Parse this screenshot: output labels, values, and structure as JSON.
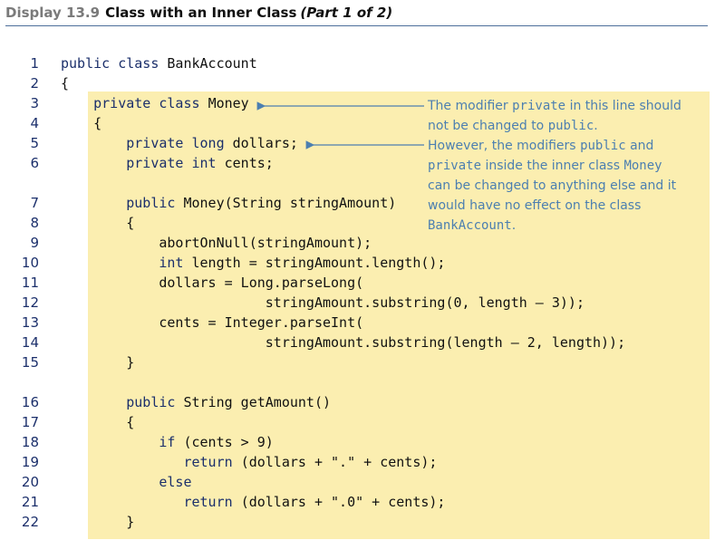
{
  "header": {
    "display": "Display 13.9",
    "title": "Class with an Inner Class",
    "part": "(Part 1 of 2)"
  },
  "lines": [
    {
      "n": "1",
      "segs": [
        [
          "kw",
          "public class "
        ],
        [
          "tx",
          "BankAccount"
        ]
      ]
    },
    {
      "n": "2",
      "segs": [
        [
          "tx",
          "{"
        ]
      ]
    },
    {
      "n": "3",
      "segs": [
        [
          "tx",
          "    "
        ],
        [
          "kw",
          "private class "
        ],
        [
          "tx",
          "Money"
        ]
      ]
    },
    {
      "n": "4",
      "segs": [
        [
          "tx",
          "    {"
        ]
      ]
    },
    {
      "n": "5",
      "segs": [
        [
          "tx",
          "        "
        ],
        [
          "kw",
          "private long "
        ],
        [
          "tx",
          "dollars;"
        ]
      ]
    },
    {
      "n": "6",
      "segs": [
        [
          "tx",
          "        "
        ],
        [
          "kw",
          "private int "
        ],
        [
          "tx",
          "cents;"
        ]
      ]
    },
    {
      "n": "7",
      "segs": [
        [
          "tx",
          "        "
        ],
        [
          "kw",
          "public "
        ],
        [
          "tx",
          "Money(String stringAmount)"
        ]
      ]
    },
    {
      "n": "8",
      "segs": [
        [
          "tx",
          "        {"
        ]
      ]
    },
    {
      "n": "9",
      "segs": [
        [
          "tx",
          "            abortOnNull(stringAmount);"
        ]
      ]
    },
    {
      "n": "10",
      "segs": [
        [
          "tx",
          "            "
        ],
        [
          "kw",
          "int "
        ],
        [
          "tx",
          "length = stringAmount.length();"
        ]
      ]
    },
    {
      "n": "11",
      "segs": [
        [
          "tx",
          "            dollars = Long.parseLong("
        ]
      ]
    },
    {
      "n": "12",
      "segs": [
        [
          "tx",
          "                         stringAmount.substring(0, length – 3));"
        ]
      ]
    },
    {
      "n": "13",
      "segs": [
        [
          "tx",
          "            cents = Integer.parseInt("
        ]
      ]
    },
    {
      "n": "14",
      "segs": [
        [
          "tx",
          "                         stringAmount.substring(length – 2, length));"
        ]
      ]
    },
    {
      "n": "15",
      "segs": [
        [
          "tx",
          "        }"
        ]
      ]
    },
    {
      "n": "16",
      "segs": [
        [
          "tx",
          "        "
        ],
        [
          "kw",
          "public "
        ],
        [
          "tx",
          "String getAmount()"
        ]
      ]
    },
    {
      "n": "17",
      "segs": [
        [
          "tx",
          "        {"
        ]
      ]
    },
    {
      "n": "18",
      "segs": [
        [
          "tx",
          "            "
        ],
        [
          "kw",
          "if "
        ],
        [
          "tx",
          "(cents > 9)"
        ]
      ]
    },
    {
      "n": "19",
      "segs": [
        [
          "tx",
          "               "
        ],
        [
          "kw",
          "return "
        ],
        [
          "tx",
          "(dollars + \".\" + cents);"
        ]
      ]
    },
    {
      "n": "20",
      "segs": [
        [
          "tx",
          "            "
        ],
        [
          "kw",
          "else"
        ]
      ]
    },
    {
      "n": "21",
      "segs": [
        [
          "tx",
          "               "
        ],
        [
          "kw",
          "return "
        ],
        [
          "tx",
          "(dollars + \".0\" + cents);"
        ]
      ]
    },
    {
      "n": "22",
      "segs": [
        [
          "tx",
          "        }"
        ]
      ]
    }
  ],
  "annotation": {
    "lines": [
      [
        [
          "t",
          "The modifier "
        ],
        [
          "m",
          "private"
        ],
        [
          "t",
          " in this line should"
        ]
      ],
      [
        [
          "t",
          "not be changed to "
        ],
        [
          "m",
          "public"
        ],
        [
          "t",
          "."
        ]
      ],
      [
        [
          "t",
          "However, the modifiers "
        ],
        [
          "m",
          "public"
        ],
        [
          "t",
          " and"
        ]
      ],
      [
        [
          "m",
          "private"
        ],
        [
          "t",
          " inside the inner class "
        ],
        [
          "m",
          "Money"
        ]
      ],
      [
        [
          "t",
          "can be changed to anything else and it"
        ]
      ],
      [
        [
          "t",
          "would have no effect on the class"
        ]
      ],
      [
        [
          "m",
          "BankAccount"
        ],
        [
          "t",
          "."
        ]
      ]
    ]
  },
  "colors": {
    "keyword": "#1b2f6b",
    "text": "#111111",
    "annotation": "#4c7fb0",
    "panel": "#fbeeb0",
    "rule": "#4c6e9a"
  }
}
